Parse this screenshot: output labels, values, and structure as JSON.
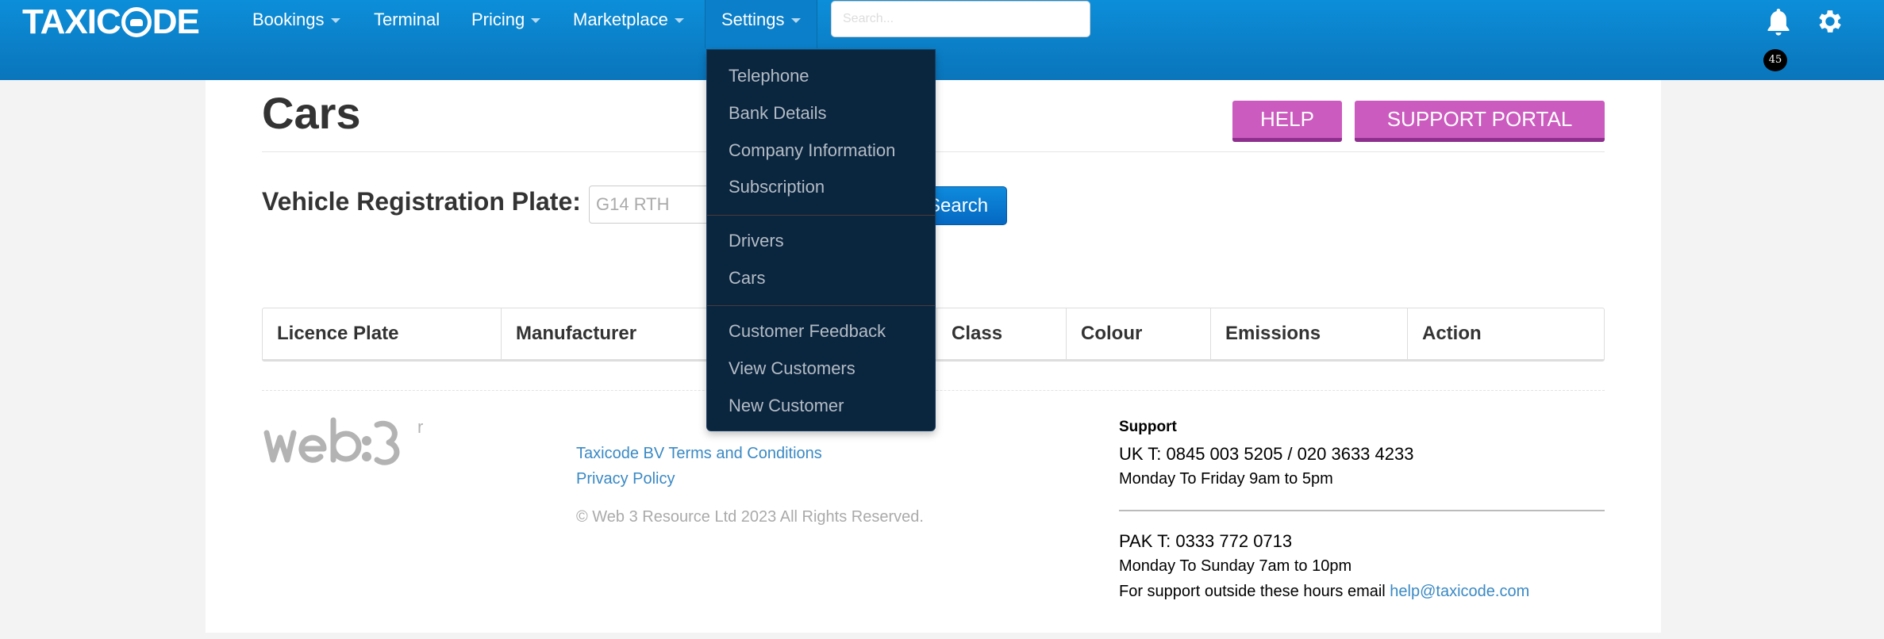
{
  "navbar": {
    "logo_text_1": "TAXIC",
    "logo_text_2": "DE",
    "items": [
      {
        "label": "Bookings",
        "has_caret": true
      },
      {
        "label": "Terminal",
        "has_caret": false
      },
      {
        "label": "Pricing",
        "has_caret": true
      },
      {
        "label": "Marketplace",
        "has_caret": true
      },
      {
        "label": "Settings",
        "has_caret": true
      }
    ],
    "search_placeholder": "Search...",
    "notification_count": "45",
    "icons": [
      "bell-icon",
      "gear-icon"
    ]
  },
  "settings_menu": {
    "group1": [
      "Telephone",
      "Bank Details",
      "Company Information",
      "Subscription"
    ],
    "group2": [
      "Drivers",
      "Cars"
    ],
    "group3": [
      "Customer Feedback",
      "View Customers",
      "New Customer"
    ]
  },
  "page": {
    "title": "Cars",
    "help_label": "HELP",
    "support_portal_label": "SUPPORT PORTAL",
    "plate_label": "Vehicle Registration Plate:",
    "plate_placeholder": "G14 RTH",
    "search_button": "Search"
  },
  "table": {
    "headers": [
      "Licence Plate",
      "Manufacturer",
      "",
      "Class",
      "Colour",
      "Emissions",
      "Action"
    ]
  },
  "footer": {
    "terms_link": "Taxicode BV Terms and Conditions",
    "privacy_link": "Privacy Policy",
    "copyright": "© Web 3 Resource Ltd 2023 All Rights Reserved.",
    "support_title": "Support",
    "uk_phone": "UK T: 0845 003 5205 / 020 3633 4233",
    "uk_hours": "Monday To Friday 9am to 5pm",
    "pak_phone": "PAK T: 0333 772 0713",
    "pak_hours": "Monday To Sunday 7am to 10pm",
    "outside_hours_text": "For support outside these hours email ",
    "support_email": "help@taxicode.com"
  },
  "colors": {
    "navbar": "#0a84cc",
    "dropdown_bg": "#0a253e",
    "pink_button": "#cc5bbf",
    "link": "#3a89c4",
    "search_button": "#0a78d0"
  }
}
